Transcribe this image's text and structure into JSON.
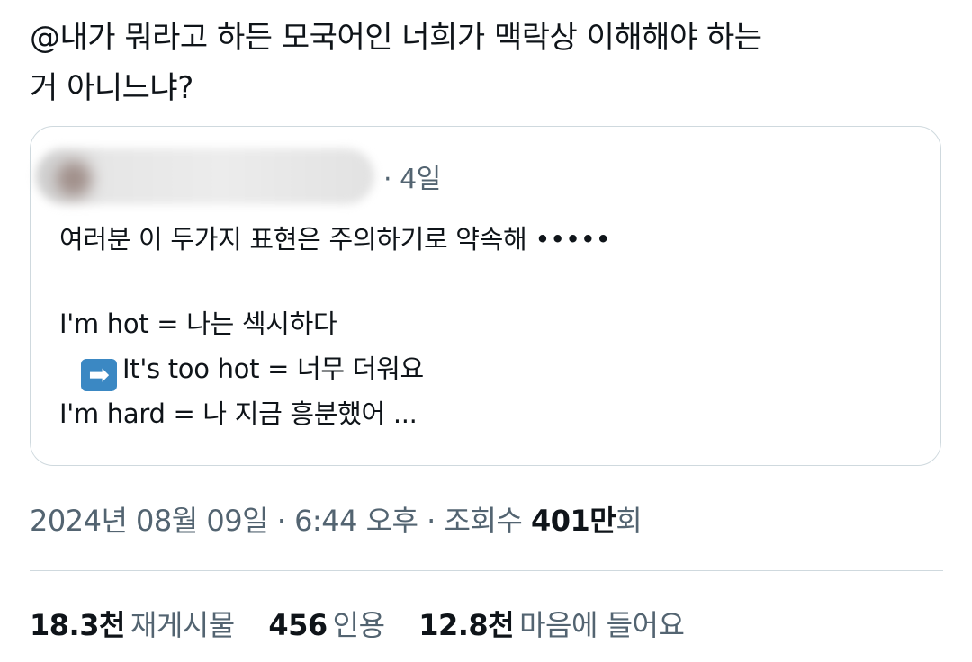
{
  "tweet": {
    "text": "@내가 뭐라고 하든 모국어인 너희가 맥락상 이해해야 하는\n거 아니느냐?"
  },
  "quote": {
    "time": "· 4일",
    "lines": [
      "여러분 이 두가지 표현은 주의하기로 약속해 •••••",
      "",
      "I'm hot = 나는 섹시하다",
      "It's too hot = 너무 더워요",
      "I'm hard = 나 지금 흥분했어 ..."
    ],
    "arrow_glyph": "➡"
  },
  "meta": {
    "date": "2024년 08월 09일",
    "sep1": " · ",
    "time": "6:44 오후",
    "sep2": " · ",
    "views_label": "조회수 ",
    "views_count": "401만",
    "views_suffix": "회"
  },
  "stats": {
    "retweets_count": "18.3천",
    "retweets_label": "재게시물",
    "quotes_count": "456",
    "quotes_label": "인용",
    "likes_count": "12.8천",
    "likes_label": "마음에 들어요"
  },
  "colors": {
    "text": "#0f1419",
    "secondary": "#536471",
    "border": "#cfd9de",
    "arrow_bg": "#3b88c3"
  }
}
